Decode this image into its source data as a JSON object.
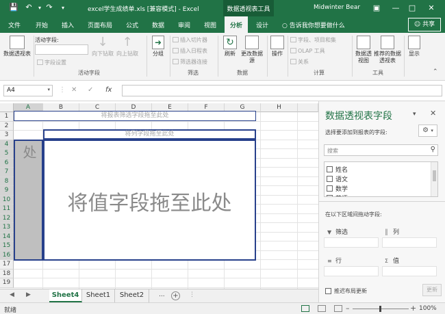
{
  "titlebar": {
    "title": "excel学生成绩单.xls  [兼容模式]  -  Excel",
    "context_tab": "数据透视表工具",
    "user": "Midwinter Bear"
  },
  "tabs": {
    "items": [
      "文件",
      "开始",
      "插入",
      "页面布局",
      "公式",
      "数据",
      "审阅",
      "视图",
      "分析",
      "设计"
    ],
    "active": "分析",
    "tell_me": "告诉我你想要做什么",
    "share": "共享"
  },
  "ribbon": {
    "pivot_table": "数据透视表",
    "active_field_label": "活动字段:",
    "field_settings": "字段设置",
    "drill_down": "向下钻取",
    "drill_up": "向上钻取",
    "group_active_field": "活动字段",
    "group": "分组",
    "insert_slicer": "插入切片器",
    "insert_timeline": "插入日程表",
    "filter_connections": "筛选器连接",
    "group_filter": "筛选",
    "refresh": "刷新",
    "change_source": "更改数据源",
    "group_data": "数据",
    "actions": "操作",
    "fields_items_sets": "字段、项目和集",
    "olap_tools": "OLAP 工具",
    "relationships": "关系",
    "group_calc": "计算",
    "pivot_chart": "数据透视图",
    "recommended": "推荐的数据透视表",
    "group_tools": "工具",
    "show": "显示"
  },
  "formula_bar": {
    "name_box": "A4",
    "fx": "fx",
    "formula": ""
  },
  "grid": {
    "columns": [
      "A",
      "B",
      "C",
      "D",
      "E",
      "F",
      "G",
      "H"
    ],
    "rows": [
      "1",
      "2",
      "3",
      "4",
      "5",
      "6",
      "7",
      "8",
      "9",
      "10",
      "11",
      "12",
      "13",
      "14",
      "15",
      "16",
      "17",
      "18",
      "19"
    ],
    "selected_column": "A",
    "selected_rows": [
      "4",
      "5",
      "6",
      "7",
      "8",
      "9",
      "10",
      "11",
      "12",
      "13",
      "14",
      "15",
      "16"
    ],
    "report_filter_hint": "将报表筛选字段拖至此处",
    "column_field_hint": "将列字段拖至此处",
    "row_field_hint": "将行字段拖至此处",
    "value_field_hint": "将值字段拖至此处"
  },
  "sheets": {
    "tabs": [
      "Sheet4",
      "Sheet1",
      "Sheet2"
    ],
    "active": "Sheet4",
    "more": "..."
  },
  "status": {
    "ready": "就绪",
    "zoom": "100%"
  },
  "pane": {
    "title": "数据透视表字段",
    "choose_prompt": "选择要添加到报表的字段:",
    "search_placeholder": "搜索",
    "fields": [
      "姓名",
      "语文",
      "数学",
      "英语"
    ],
    "drag_prompt": "在以下区域间拖动字段:",
    "areas": {
      "filters": "筛选",
      "columns": "列",
      "rows": "行",
      "values": "值"
    },
    "defer_update": "推迟布局更新",
    "update": "更新"
  },
  "colors": {
    "brand": "#217346",
    "context_tab": "#185c37",
    "pivot_border": "#27408b",
    "row_area_fill": "#bfbfbf"
  },
  "icons": [
    "save-icon",
    "undo-icon",
    "redo-icon",
    "customize-icon",
    "ribbon-display-icon",
    "minimize-icon",
    "restore-icon",
    "close-icon",
    "lightbulb-icon",
    "user-icon",
    "pivot-table-icon",
    "drill-down-icon",
    "drill-up-icon",
    "group-arrow-icon",
    "slicer-icon",
    "timeline-icon",
    "filter-connections-icon",
    "refresh-icon",
    "change-source-icon",
    "actions-icon",
    "pivot-chart-icon",
    "recommended-icon",
    "show-icon",
    "cancel-icon",
    "enter-icon",
    "gear-icon",
    "search-icon",
    "filter-icon",
    "columns-icon",
    "rows-icon",
    "sigma-icon"
  ]
}
